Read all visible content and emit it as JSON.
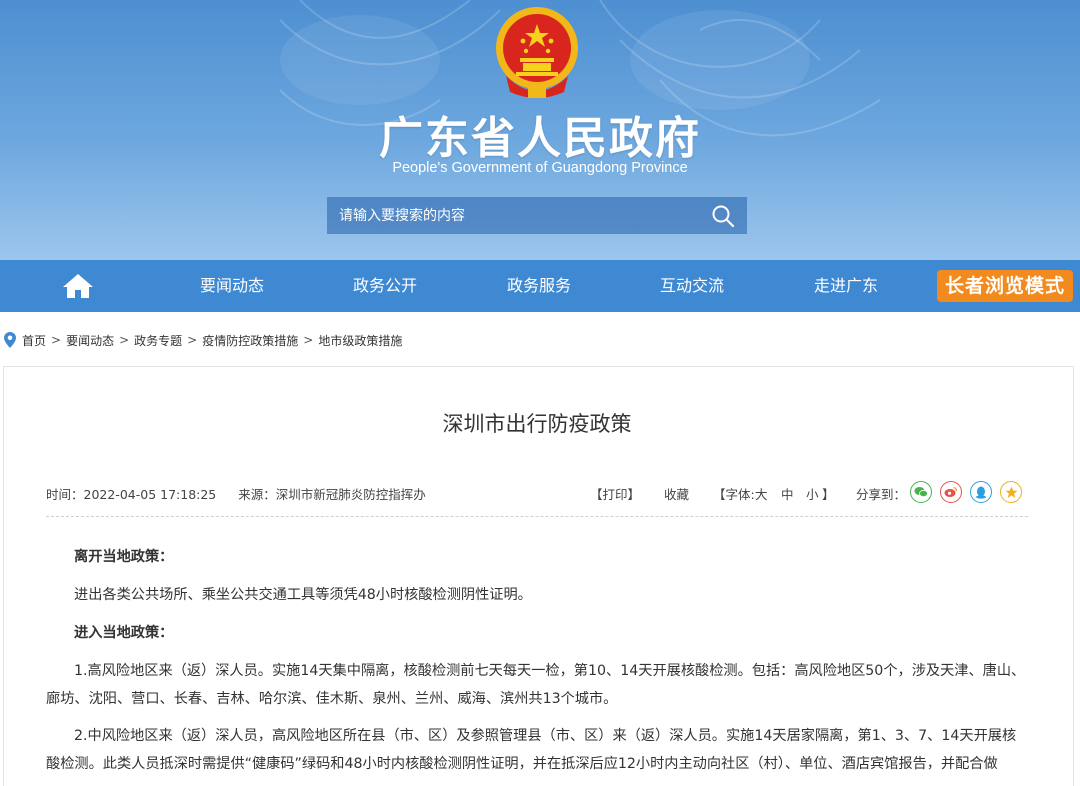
{
  "header": {
    "title": "广东省人民政府",
    "subtitle": "People's Government of Guangdong Province",
    "search_placeholder": "请输入要搜索的内容"
  },
  "nav": {
    "items": [
      "要闻动态",
      "政务公开",
      "政务服务",
      "互动交流",
      "走进广东"
    ],
    "elder_mode": "长者浏览模式"
  },
  "breadcrumb": [
    "首页",
    "要闻动态",
    "政务专题",
    "疫情防控政策措施",
    "地市级政策措施"
  ],
  "article": {
    "title": "深圳市出行防疫政策",
    "time": "时间：2022-04-05 17:18:25",
    "source": "来源：深圳市新冠肺炎防控指挥办",
    "print": "【打印】",
    "favorite": "收藏",
    "font_label": "【字体:",
    "font_large": "大",
    "font_medium": "中",
    "font_small": "小",
    "font_close": "】",
    "share_label": "分享到：",
    "share_icons": [
      "wechat-icon",
      "weibo-icon",
      "qq-icon",
      "qzone-icon"
    ],
    "paragraphs": [
      "离开当地政策：",
      "进出各类公共场所、乘坐公共交通工具等须凭48小时核酸检测阴性证明。",
      "进入当地政策：",
      "1.高风险地区来（返）深人员。实施14天集中隔离，核酸检测前七天每天一检，第10、14天开展核酸检测。包括：高风险地区50个，涉及天津、唐山、廊坊、沈阳、营口、长春、吉林、哈尔滨、佳木斯、泉州、兰州、威海、滨州共13个城市。",
      "2.中风险地区来（返）深人员，高风险地区所在县（市、区）及参照管理县（市、区）来（返）深人员。实施14天居家隔离，第1、3、7、14天开展核酸检测。此类人员抵深时需提供“健康码”绿码和48小时内核酸检测阴性证明，并在抵深后应12小时内主动向社区（村）、单位、酒店宾馆报告，并配合做"
    ]
  },
  "colors": {
    "banner_top": "#4d8fd1",
    "nav_bg": "#3f88d2",
    "elder_btn": "#f28a1e"
  }
}
